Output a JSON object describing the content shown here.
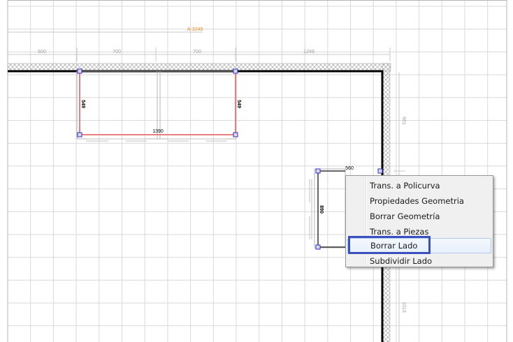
{
  "drawing": {
    "title_dimension": "A-3249",
    "top_dimensions": [
      "600",
      "700",
      "700",
      "1249"
    ],
    "right_dimensions": [
      "661",
      "1013"
    ],
    "module1": {
      "left_depth": "549",
      "right_depth": "549",
      "width": "1390"
    },
    "module2": {
      "top_width": "560",
      "depth": "890"
    }
  },
  "context_menu": {
    "items": [
      {
        "label": "Trans. a Policurva"
      },
      {
        "label": "Propiedades Geometria"
      },
      {
        "label": "Borrar Geometría"
      },
      {
        "label": "Trans. a Piezas"
      },
      {
        "label": "Borrar Lado"
      },
      {
        "label": "Subdividir Lado"
      }
    ]
  },
  "colors": {
    "grid": "#d9d9d9",
    "wall": "#000000",
    "selected_edge": "#e88080",
    "vertex": "#3030c0",
    "dimension_text": "#f08c1e",
    "annotation_box": "#3c4fbf"
  }
}
